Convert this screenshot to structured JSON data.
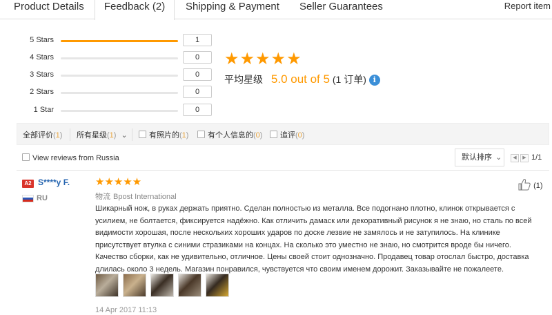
{
  "tabs": {
    "items": [
      {
        "label": "Product Details"
      },
      {
        "label": "Feedback (2)"
      },
      {
        "label": "Shipping & Payment"
      },
      {
        "label": "Seller Guarantees"
      }
    ],
    "active_index": 1,
    "report_label": "Report item"
  },
  "ratings": {
    "rows": [
      {
        "label": "5 Stars",
        "count": "1",
        "fill": 1.0
      },
      {
        "label": "4 Stars",
        "count": "0",
        "fill": 0.0
      },
      {
        "label": "3 Stars",
        "count": "0",
        "fill": 0.0
      },
      {
        "label": "2 Stars",
        "count": "0",
        "fill": 0.0
      },
      {
        "label": "1 Star",
        "count": "0",
        "fill": 0.0
      }
    ],
    "star_color": "#ff9900"
  },
  "summary": {
    "stars": "★★★★★",
    "prefix": "平均星级",
    "score": "5.0 out of 5",
    "orders": "(1 订单)",
    "info_icon": "i"
  },
  "filter": {
    "all_label": "全部评价",
    "all_count_open": "(",
    "all_count": "1",
    "all_count_close": ")",
    "stars_label": "所有星级",
    "stars_count_open": "(",
    "stars_count": "1",
    "stars_count_close": ")",
    "chevron": "⌄",
    "photos_label": "有照片的",
    "photos_count_open": "(",
    "photos_count": "1",
    "photos_count_close": ")",
    "info_label": "有个人信息的",
    "info_count_open": "(",
    "info_count": "0",
    "info_count_close": ")",
    "followup_label": "追评",
    "followup_count_open": "(",
    "followup_count": "0",
    "followup_count_close": ")"
  },
  "view_country_label": "View reviews from Russia",
  "sort": {
    "label": "默认排序",
    "chevron": "⌄"
  },
  "pager": {
    "prev": "◀",
    "next": "▶",
    "text": "1/1"
  },
  "review": {
    "level_badge": "A2",
    "user": "S****y F.",
    "country": "RU",
    "stars": "★★★★★",
    "logistics_label": "物流",
    "logistics_value": "Bpost International",
    "text": "Шикарный нож, в руках держать приятно. Сделан полностью из металла. Все подогнано плотно, клинок открывается с усилием, не болтается, фиксируется надёжно. Как отличить дамаск или декоративный рисунок я не знаю, но сталь по всей видимости хорошая, после нескольких хороших ударов по доске лезвие не замялось и не затупилось. На клинике присутствует втулка с синими стразиками на концах. На сколько это уместно не знаю, но смотрится вроде бы ничего. Качество сборки, как не удивительно, отличное. Цены своей стоит однозначно. Продавец товар отослал быстро, доставка длилась около 3 недель. Магазин понравился, чувствуется что своим именем дорожит. Заказывайте не пожалеете.",
    "date": "14 Apr 2017 11:13",
    "likes": "(1)",
    "photos": [
      {
        "name": "review-photo-1",
        "colors": [
          "#6e5a43",
          "#b9ad9a",
          "#3e3328"
        ]
      },
      {
        "name": "review-photo-2",
        "colors": [
          "#8a6b4a",
          "#c9b18d",
          "#4a3a2a"
        ]
      },
      {
        "name": "review-photo-3",
        "colors": [
          "#e9e6e0",
          "#3a2e24",
          "#bfb8ad"
        ]
      },
      {
        "name": "review-photo-4",
        "colors": [
          "#e4e1dc",
          "#4a3828",
          "#9a8c7a"
        ]
      },
      {
        "name": "review-photo-5",
        "colors": [
          "#e8e4dd",
          "#352a20",
          "#d5a832"
        ]
      }
    ]
  }
}
